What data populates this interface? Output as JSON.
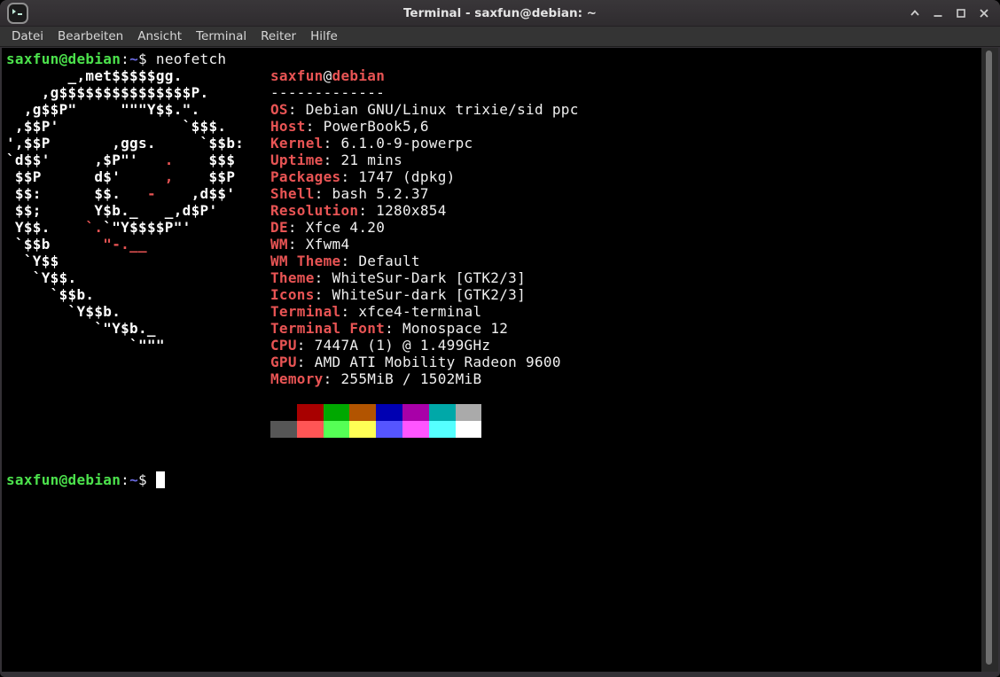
{
  "window": {
    "title": "Terminal - saxfun@debian: ~",
    "controls": [
      "shade",
      "minimize",
      "maximize",
      "close"
    ]
  },
  "menu": {
    "items": [
      "Datei",
      "Bearbeiten",
      "Ansicht",
      "Terminal",
      "Reiter",
      "Hilfe"
    ]
  },
  "terminal": {
    "colors": {
      "fg": "#f0f0f0",
      "boldfg": "#ffffff",
      "red": "#e85454",
      "green": "#4ce24c",
      "blue": "#6a6ae0",
      "cursor": "#ffffff",
      "background": "#000000"
    },
    "palette": {
      "bg0": "#000000",
      "bg1": "#a80000",
      "bg2": "#00a800",
      "bg3": "#b25400",
      "bg4": "#0000b2",
      "bg5": "#a800a8",
      "bg6": "#00a8a8",
      "bg7": "#aaaaaa",
      "bg8": "#565656",
      "bg9": "#ff5555",
      "bg10": "#55ff55",
      "bg11": "#ffff55",
      "bg12": "#5555ff",
      "bg13": "#ff55ff",
      "bg14": "#55ffff",
      "bg15": "#ffffff"
    },
    "info": {
      "title": "saxfun@debian",
      "OS": "Debian GNU/Linux trixie/sid ppc",
      "Host": "PowerBook5,6",
      "Kernel": "6.1.0-9-powerpc",
      "Uptime": "21 mins",
      "Packages": "1747 (dpkg)",
      "Shell": "bash 5.2.37",
      "Resolution": "1280x854",
      "DE": "Xfce 4.20",
      "WM": "Xfwm4",
      "WM Theme": "Default",
      "Theme": "WhiteSur-Dark [GTK2/3]",
      "Icons": "WhiteSur-dark [GTK2/3]",
      "Terminal": "xfce4-terminal",
      "Terminal Font": "Monospace 12",
      "CPU": "7447A (1) @ 1.499GHz",
      "GPU": "AMD ATI Mobility Radeon 9600",
      "Memory": "255MiB / 1502MiB"
    },
    "lines": [
      [
        [
          "g",
          "saxfun@debian"
        ],
        [
          "w",
          ":"
        ],
        [
          "b",
          "~"
        ],
        [
          "w",
          "$ neofetch"
        ]
      ],
      [
        [
          "W",
          "       _,met$$$$$gg.          "
        ],
        [
          "r",
          "saxfun"
        ],
        [
          "w",
          "@"
        ],
        [
          "r",
          "debian"
        ]
      ],
      [
        [
          "W",
          "    ,g$$$$$$$$$$$$$$$P.       "
        ],
        [
          "w",
          "-------------"
        ]
      ],
      [
        [
          "W",
          "  ,g$$P\"     \"\"\"Y$$.\".        "
        ],
        [
          "r",
          "OS"
        ],
        [
          "w",
          ": Debian GNU/Linux trixie/sid ppc"
        ]
      ],
      [
        [
          "W",
          " ,$$P'              `$$$.     "
        ],
        [
          "r",
          "Host"
        ],
        [
          "w",
          ": PowerBook5,6"
        ]
      ],
      [
        [
          "W",
          "',$$P       ,ggs.     `$$b:   "
        ],
        [
          "r",
          "Kernel"
        ],
        [
          "w",
          ": 6.1.0-9-powerpc"
        ]
      ],
      [
        [
          "W",
          "`d$$'     ,$P\"'   "
        ],
        [
          "r",
          "."
        ],
        [
          "W",
          "    $$$    "
        ],
        [
          "r",
          "Uptime"
        ],
        [
          "w",
          ": 21 mins"
        ]
      ],
      [
        [
          "W",
          " $$P      d$'     "
        ],
        [
          "r",
          ","
        ],
        [
          "W",
          "    $$P    "
        ],
        [
          "r",
          "Packages"
        ],
        [
          "w",
          ": 1747 (dpkg)"
        ]
      ],
      [
        [
          "W",
          " $$:      $$.   "
        ],
        [
          "r",
          "-"
        ],
        [
          "W",
          "    ,d$$'    "
        ],
        [
          "r",
          "Shell"
        ],
        [
          "w",
          ": bash 5.2.37"
        ]
      ],
      [
        [
          "W",
          " $$;      Y$b._   _,d$P'      "
        ],
        [
          "r",
          "Resolution"
        ],
        [
          "w",
          ": 1280x854"
        ]
      ],
      [
        [
          "W",
          " Y$$.    "
        ],
        [
          "r",
          "`."
        ],
        [
          "W",
          "`\"Y$$$$P\"'         "
        ],
        [
          "r",
          "DE"
        ],
        [
          "w",
          ": Xfce 4.20"
        ]
      ],
      [
        [
          "W",
          " `$$b      "
        ],
        [
          "r",
          "\"-.__"
        ],
        [
          "W",
          "              "
        ],
        [
          "r",
          "WM"
        ],
        [
          "w",
          ": Xfwm4"
        ]
      ],
      [
        [
          "W",
          "  `Y$$                        "
        ],
        [
          "r",
          "WM Theme"
        ],
        [
          "w",
          ": Default"
        ]
      ],
      [
        [
          "W",
          "   `Y$$.                      "
        ],
        [
          "r",
          "Theme"
        ],
        [
          "w",
          ": WhiteSur-Dark [GTK2/3]"
        ]
      ],
      [
        [
          "W",
          "     `$$b.                    "
        ],
        [
          "r",
          "Icons"
        ],
        [
          "w",
          ": WhiteSur-dark [GTK2/3]"
        ]
      ],
      [
        [
          "W",
          "       `Y$$b.                 "
        ],
        [
          "r",
          "Terminal"
        ],
        [
          "w",
          ": xfce4-terminal"
        ]
      ],
      [
        [
          "W",
          "          `\"Y$b._             "
        ],
        [
          "r",
          "Terminal Font"
        ],
        [
          "w",
          ": Monospace 12"
        ]
      ],
      [
        [
          "W",
          "              `\"\"\"            "
        ],
        [
          "r",
          "CPU"
        ],
        [
          "w",
          ": 7447A (1) @ 1.499GHz"
        ]
      ],
      [
        [
          "w",
          "                              "
        ],
        [
          "r",
          "GPU"
        ],
        [
          "w",
          ": AMD ATI Mobility Radeon 9600"
        ]
      ],
      [
        [
          "w",
          "                              "
        ],
        [
          "r",
          "Memory"
        ],
        [
          "w",
          ": 255MiB / 1502MiB"
        ]
      ],
      [],
      [
        [
          "w",
          "                              "
        ],
        [
          "bg0",
          "   "
        ],
        [
          "bg1",
          "   "
        ],
        [
          "bg2",
          "   "
        ],
        [
          "bg3",
          "   "
        ],
        [
          "bg4",
          "   "
        ],
        [
          "bg5",
          "   "
        ],
        [
          "bg6",
          "   "
        ],
        [
          "bg7",
          "   "
        ]
      ],
      [
        [
          "w",
          "                              "
        ],
        [
          "bg8",
          "   "
        ],
        [
          "bg9",
          "   "
        ],
        [
          "bg10",
          "   "
        ],
        [
          "bg11",
          "   "
        ],
        [
          "bg12",
          "   "
        ],
        [
          "bg13",
          "   "
        ],
        [
          "bg14",
          "   "
        ],
        [
          "bg15",
          "   "
        ]
      ],
      [],
      [],
      [
        [
          "g",
          "saxfun@debian"
        ],
        [
          "w",
          ":"
        ],
        [
          "b",
          "~"
        ],
        [
          "w",
          "$ "
        ],
        [
          "cursor",
          " "
        ]
      ]
    ]
  }
}
